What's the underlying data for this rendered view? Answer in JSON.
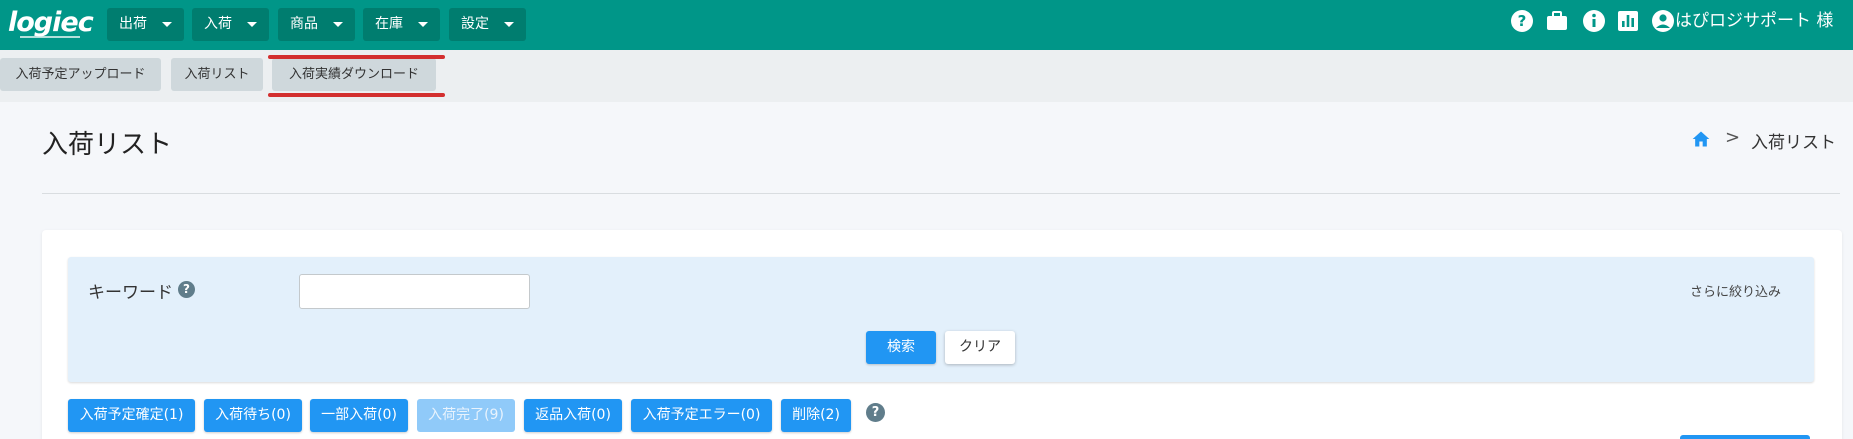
{
  "header": {
    "logo_text": "logiec",
    "menus": [
      {
        "label": "出荷"
      },
      {
        "label": "入荷"
      },
      {
        "label": "商品"
      },
      {
        "label": "在庫"
      },
      {
        "label": "設定"
      }
    ],
    "user_name": "はぴロジサポート 様",
    "icons": [
      "help-icon",
      "briefcase-icon",
      "info-icon",
      "bar-chart-icon",
      "account-circle-icon"
    ]
  },
  "subnav": {
    "tabs": [
      {
        "label": "入荷予定アップロード"
      },
      {
        "label": "入荷リスト"
      },
      {
        "label": "入荷実績ダウンロード",
        "highlighted": true
      }
    ]
  },
  "page": {
    "title": "入荷リスト",
    "breadcrumb": {
      "separator": ">",
      "current": "入荷リスト"
    }
  },
  "filter": {
    "keyword_label": "キーワード",
    "keyword_value": "",
    "more_link": "さらに絞り込み",
    "search_label": "検索",
    "clear_label": "クリア"
  },
  "status_buttons": [
    {
      "label": "入荷予定確定(1)",
      "enabled": true
    },
    {
      "label": "入荷待ち(0)",
      "enabled": true
    },
    {
      "label": "一部入荷(0)",
      "enabled": true
    },
    {
      "label": "入荷完了(9)",
      "enabled": false
    },
    {
      "label": "返品入荷(0)",
      "enabled": true
    },
    {
      "label": "入荷予定エラー(0)",
      "enabled": true
    },
    {
      "label": "削除(2)",
      "enabled": true
    }
  ],
  "colors": {
    "header_bg": "#009688",
    "primary": "#2196f3",
    "highlight_underline": "#d32f2f"
  }
}
